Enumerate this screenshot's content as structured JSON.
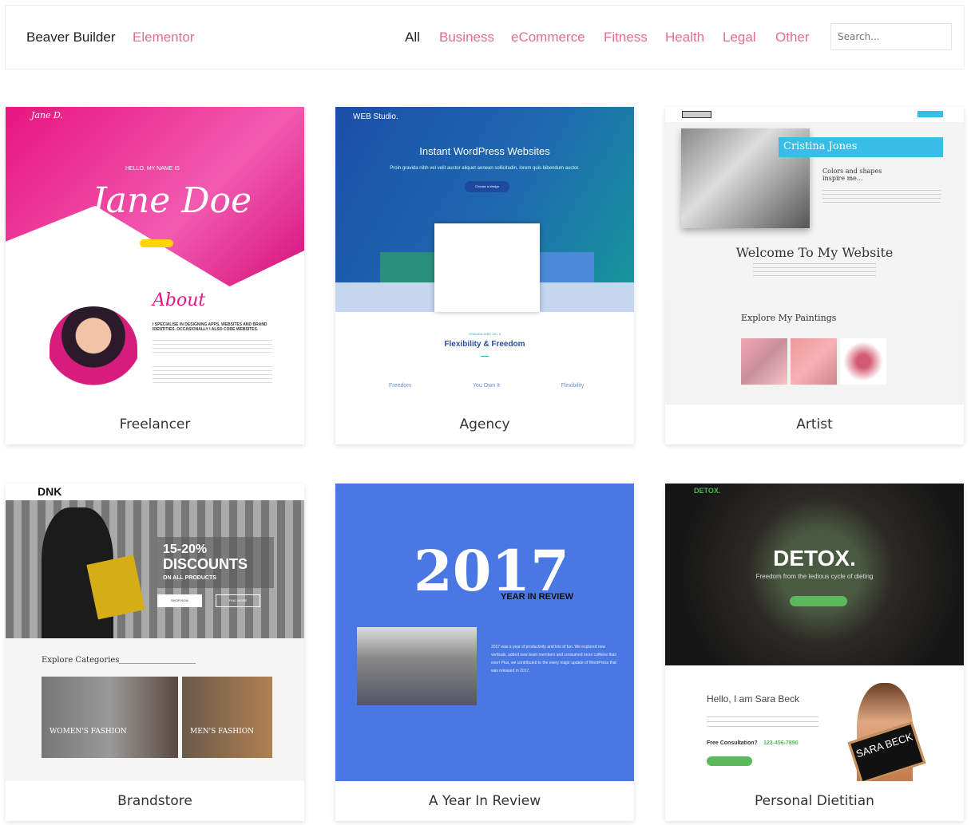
{
  "header": {
    "builders": [
      "Beaver Builder",
      "Elementor"
    ],
    "categories": [
      "All",
      "Business",
      "eCommerce",
      "Fitness",
      "Health",
      "Legal",
      "Other"
    ],
    "active_category": "All",
    "search_placeholder": "Search..."
  },
  "colors": {
    "accent": "#e66b97",
    "active": "#222222"
  },
  "templates": [
    {
      "name": "Freelancer",
      "logo": "Jane D.",
      "hello": "HELLO, MY NAME IS",
      "hero": "Jane Doe",
      "about": "About",
      "about_text": "I SPECIALISE IN DESIGNING APPS, WEBSITES AND BRAND IDENTITIES. OCCASIONALLY I ALSO CODE WEBSITES."
    },
    {
      "name": "Agency",
      "logo": "WEB Studio.",
      "hero": "Instant WordPress Websites",
      "sub": "Proin gravida nibh vel velit auctor aliquet aenean sollicitudin, lorem quis bibendum auctor.",
      "cta": "Choose a design",
      "kicker": "GRAVIDA NIBH VEL 5",
      "section": "Flexibility & Freedom",
      "features": [
        "Freedom",
        "You Own It",
        "Flexibility"
      ]
    },
    {
      "name": "Artist",
      "banner": "Cristina Jones",
      "tagline": "Colors and shapes inspire me...",
      "welcome": "Welcome To My Website",
      "paintings": "Explore My Paintings"
    },
    {
      "name": "Brandstore",
      "logo": "DNK",
      "promo1": "15-20%",
      "promo2": "DISCOUNTS",
      "promo3": "ON ALL PRODUCTS",
      "shop": "SHOP NOW",
      "find": "FIND MORE",
      "explore": "Explore Categories",
      "cats": [
        "WOMEN'S FASHION",
        "MEN'S FASHION"
      ]
    },
    {
      "name": "A Year In Review",
      "year": "2017",
      "sub": "YEAR IN REVIEW",
      "body": "2017 was a year of productivity and lots of fun. We explored new verticals, added new team members and consumed more caffeine than ever! Plus, we contributed to the every major update of WordPress that was released in 2017."
    },
    {
      "name": "Personal Dietitian",
      "logo": "DETOX.",
      "hero": "DETOX.",
      "sub": "Freedom from the tedious cycle of dieting",
      "hello": "Hello, I am Sara Beck",
      "consult": "Free Consultation?",
      "phone": "123-456-7890",
      "sign": "SARA BECK"
    }
  ]
}
